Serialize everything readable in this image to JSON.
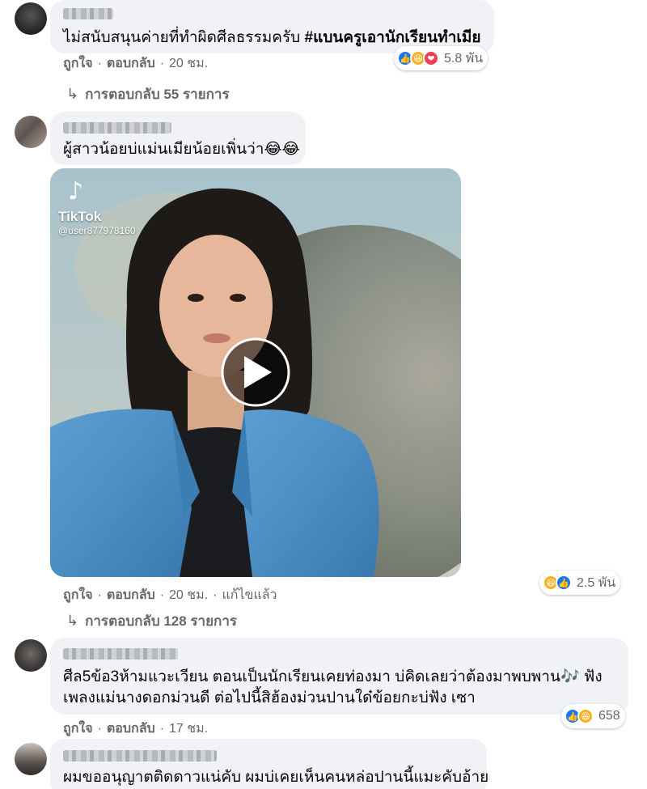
{
  "comments": [
    {
      "text": "ไม่สนับสนุนค่ายที่ทำผิดศีลธรรมครับ",
      "hashtag": "#แบนครูเอานักเรียนทำเมีย",
      "reaction_count": "5.8 พัน",
      "like_label": "ถูกใจ",
      "reply_label": "ตอบกลับ",
      "time": "20 ชม.",
      "replies_label": "การตอบกลับ 55 รายการ"
    },
    {
      "text": "ผู้สาวน้อยบ่แม่นเมียน้อยเพิ่นว่า😂😂",
      "video": {
        "brand": "TikTok",
        "user": "@user877978160"
      },
      "reaction_count": "2.5 พัน",
      "like_label": "ถูกใจ",
      "reply_label": "ตอบกลับ",
      "time": "20 ชม.",
      "edited_label": "แก้ไขแล้ว",
      "replies_label": "การตอบกลับ 128 รายการ"
    },
    {
      "text_line1": "ศีล5ข้อ3ห้ามแวะเวียน ตอนเป็นนักเรียนเคยท่องมา บ่คิดเลยว่าต้องมาพบพาน🎶 ฟัง",
      "text_line2": "เพลงแม่นางดอกม่วนดี ต่อไปนี้สิฮ้องม่วนปานใด๋ข้อยกะบ่ฟัง เซา",
      "reaction_count": "658",
      "like_label": "ถูกใจ",
      "reply_label": "ตอบกลับ",
      "time": "17 ชม."
    },
    {
      "text": "ผมขออนุญาตติดดาวแน่คับ ผมบ่เคยเห็นคนหล่อปานนี้แมะคับอ้าย"
    }
  ],
  "colors": {
    "bubble": "#f0f2f5",
    "meta_text": "#65676b",
    "like": "#1877f2",
    "haha": "#f7b125",
    "love": "#f33e58"
  }
}
